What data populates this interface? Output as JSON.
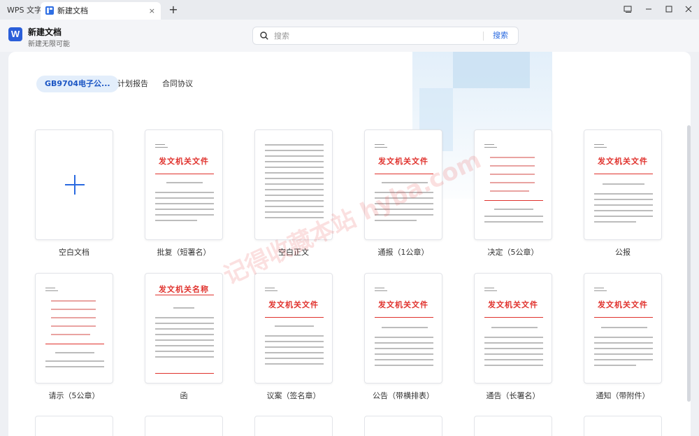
{
  "titlebar": {
    "app_name": "WPS 文字",
    "tab_label": "新建文档",
    "tab_close": "×",
    "new_tab": "+"
  },
  "header": {
    "title": "新建文档",
    "subtitle": "新建无限可能",
    "logo_letter": "W",
    "search_placeholder": "搜索",
    "search_button": "搜索"
  },
  "categories": [
    {
      "label": "GB9704电子公...",
      "active": true
    },
    {
      "label": "计划报告",
      "active": false
    },
    {
      "label": "合同协议",
      "active": false
    }
  ],
  "templates_row1": [
    "空白文档",
    "批复（短署名）",
    "空白正文",
    "通报（1公章）",
    "决定（5公章）",
    "公报"
  ],
  "templates_row2": [
    "请示（5公章）",
    "函",
    "议案（签名章）",
    "公告（带横排表）",
    "通告（长署名）",
    "通知（带附件）"
  ],
  "doc_heading": "发文机关文件",
  "doc_heading_alt": "发文机关名称",
  "watermark": "记得收藏本站 hyba.com",
  "colors": {
    "accent": "#2a6ae0",
    "doc_red": "#e0322d"
  }
}
